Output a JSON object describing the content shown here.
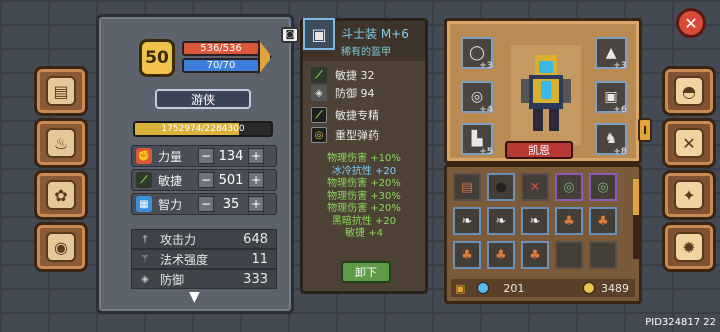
{
  "level": "50",
  "hp": "536/536",
  "mp": "70/70",
  "class_name": "游侠",
  "exp_text": "1752974/2284300",
  "exp_fraction": 0.767,
  "attributes": [
    {
      "label": "力量",
      "value": "134",
      "icon": "fist-icon",
      "color": "#d9573a"
    },
    {
      "label": "敏捷",
      "value": "501",
      "icon": "feather-icon",
      "color": "#5ab84a"
    },
    {
      "label": "智力",
      "value": "35",
      "icon": "book-icon",
      "color": "#3c8fd8"
    }
  ],
  "combat_stats": [
    {
      "label": "攻击力",
      "value": "648",
      "icon": "sword-icon"
    },
    {
      "label": "法术强度",
      "value": "11",
      "icon": "wand-icon"
    },
    {
      "label": "防御",
      "value": "333",
      "icon": "shield-icon"
    }
  ],
  "item": {
    "name": "斗士装 M+6",
    "subtitle": "稀有的盔甲",
    "base_stats": [
      {
        "label": "敏捷 32",
        "icon": "feather-icon"
      },
      {
        "label": "防御 94",
        "icon": "shield-icon"
      }
    ],
    "traits": [
      {
        "label": "敏捷专精",
        "icon": "feather-icon"
      },
      {
        "label": "重型弹药",
        "icon": "ammo-icon"
      }
    ],
    "bonuses": [
      {
        "text": "物理伤害 +10%",
        "color": "#8ad85a"
      },
      {
        "text": "冰冷抗性 +20",
        "color": "#7ad0f0"
      },
      {
        "text": "物理伤害 +20%",
        "color": "#8ad85a"
      },
      {
        "text": "物理伤害 +30%",
        "color": "#8ad85a"
      },
      {
        "text": "物理伤害 +20%",
        "color": "#8ad85a"
      },
      {
        "text": "黑暗抗性 +20",
        "color": "#8ad85a"
      },
      {
        "text": "敏捷 +4",
        "color": "#8ad85a"
      }
    ],
    "unequip_label": "卸下"
  },
  "hero": {
    "name": "凯恩",
    "slots": [
      {
        "plus": "+3",
        "icon": "ring-icon"
      },
      {
        "plus": "+4",
        "icon": "bracelet-icon"
      },
      {
        "plus": "+5",
        "icon": "boots-icon"
      },
      {
        "plus": "+3",
        "icon": "hat-icon"
      },
      {
        "plus": "+6",
        "icon": "armor-icon"
      },
      {
        "plus": "+8",
        "icon": "pet-icon"
      }
    ],
    "side_tab": "I"
  },
  "inventory": {
    "rows": [
      [
        "chest-icon",
        "bomb-icon",
        "map-icon",
        "eye-amulet-icon",
        "eye-amulet-icon"
      ],
      [
        "feather-icon",
        "feather-icon",
        "feather-icon",
        "mushroom-icon",
        "mushroom-icon"
      ],
      [
        "mushroom-icon",
        "mushroom-icon",
        "mushroom-icon",
        "empty",
        "empty"
      ]
    ],
    "gems": "201",
    "gold": "3489"
  },
  "footer_id": "PID324817 22",
  "colors": {
    "accent": "#e0a43a",
    "hp": "#d9573a",
    "mp": "#3c7fd8"
  }
}
